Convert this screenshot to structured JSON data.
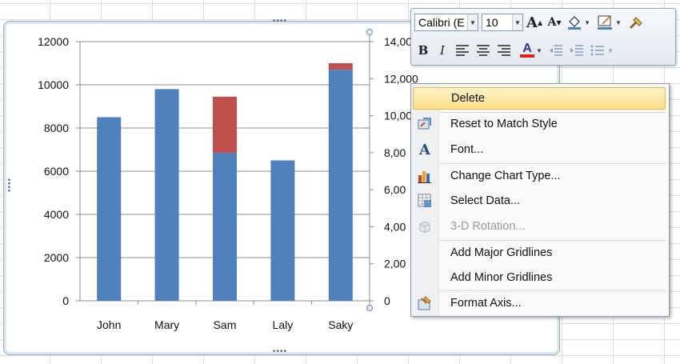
{
  "chart_data": {
    "type": "bar",
    "categories": [
      "John",
      "Mary",
      "Sam",
      "Laly",
      "Saky"
    ],
    "series": [
      {
        "values": [
          8500,
          9800,
          6850,
          6500,
          10700
        ],
        "color": "#4f81bd"
      },
      {
        "values": [
          0,
          0,
          2600,
          0,
          300
        ],
        "color": "#c0504d"
      }
    ],
    "ylim": [
      0,
      12000
    ],
    "y_ticks": [
      "0",
      "2000",
      "4000",
      "6000",
      "8000",
      "10000",
      "12000"
    ],
    "y2_ticks": [
      "0",
      "2,00",
      "4,00",
      "6,00",
      "8,00",
      "10,00",
      "12,000",
      "14,00"
    ],
    "grid": true,
    "stacked": true
  },
  "mini_toolbar": {
    "font_name": "Calibri (E",
    "font_size": "10",
    "grow_font": "A",
    "shrink_font": "A",
    "bold": "B",
    "italic": "I",
    "font_color": "A"
  },
  "context_menu": {
    "items": [
      {
        "label": "Delete",
        "icon": ""
      },
      {
        "label": "Reset to Match Style",
        "icon": "reset-style-icon"
      },
      {
        "label": "Font...",
        "icon": "font-icon"
      },
      {
        "label": "Change Chart Type...",
        "icon": "chart-type-icon"
      },
      {
        "label": "Select Data...",
        "icon": "select-data-icon"
      },
      {
        "label": "3-D Rotation...",
        "icon": "rotation-3d-icon"
      },
      {
        "label": "Add Major Gridlines",
        "icon": ""
      },
      {
        "label": "Add Minor Gridlines",
        "icon": ""
      },
      {
        "label": "Format Axis...",
        "icon": "format-axis-icon"
      }
    ]
  }
}
